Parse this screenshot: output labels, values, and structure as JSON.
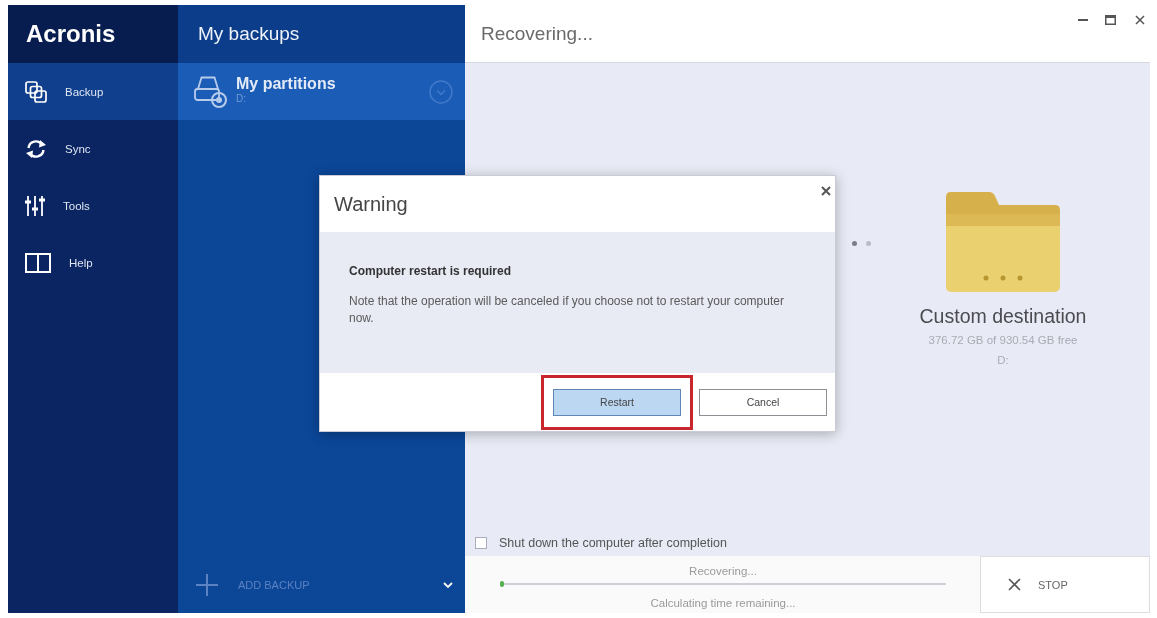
{
  "sidebar": {
    "logo": "Acronis",
    "items": [
      {
        "label": "Backup",
        "selected": true
      },
      {
        "label": "Sync",
        "selected": false
      },
      {
        "label": "Tools",
        "selected": false
      },
      {
        "label": "Help",
        "selected": false
      }
    ]
  },
  "backups": {
    "title": "My backups",
    "items": [
      {
        "name": "My partitions",
        "drive": "D:",
        "selected": true
      }
    ],
    "add_button": "ADD BACKUP"
  },
  "main": {
    "title": "Recovering...",
    "destination": {
      "name": "Custom destination",
      "details": "376.72 GB of 930.54 GB free",
      "drive": "D:"
    },
    "shutdown_checkbox": {
      "label": "Shut down the computer after completion",
      "checked": false
    },
    "progress": {
      "status": "Recovering...",
      "level": 0.01,
      "time": "Calculating time remaining..."
    },
    "stop_button": "STOP"
  },
  "dialog": {
    "title": "Warning",
    "heading": "Computer restart is required",
    "message": "Note that the operation will be canceled if you choose not to restart your computer now.",
    "buttons": [
      {
        "label": "Restart",
        "kind": "primary",
        "highlighted": true
      },
      {
        "label": "Cancel",
        "kind": "secondary",
        "highlighted": false
      }
    ]
  }
}
